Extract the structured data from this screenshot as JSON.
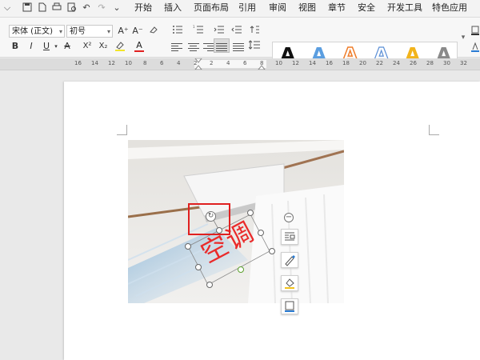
{
  "menubar": {
    "items": [
      "开始",
      "插入",
      "页面布局",
      "引用",
      "审阅",
      "视图",
      "章节",
      "安全",
      "开发工具",
      "特色应用"
    ]
  },
  "ribbon": {
    "font_name": "宋体 (正文)",
    "font_size": "初号",
    "bold": "B",
    "italic": "I",
    "underline": "U",
    "superscript": "X²",
    "subscript": "X₂",
    "font_grow": "A⁺",
    "font_shrink": "A⁻",
    "font_color": "A",
    "strikethrough": "A",
    "art_styles": [
      "A",
      "A",
      "A",
      "A",
      "A",
      "A"
    ]
  },
  "ruler": {
    "numbers": [
      "16",
      "14",
      "12",
      "10",
      "8",
      "6",
      "4",
      "2",
      "2",
      "4",
      "6",
      "8",
      "10",
      "12",
      "14",
      "16",
      "18",
      "20",
      "22",
      "24",
      "26",
      "28",
      "30",
      "32"
    ]
  },
  "document": {
    "wordart_text": "空调"
  },
  "colors": {
    "wordart": "#ea2a2a",
    "highlight_box": "#e02020",
    "accent": "#2b7cd3"
  }
}
